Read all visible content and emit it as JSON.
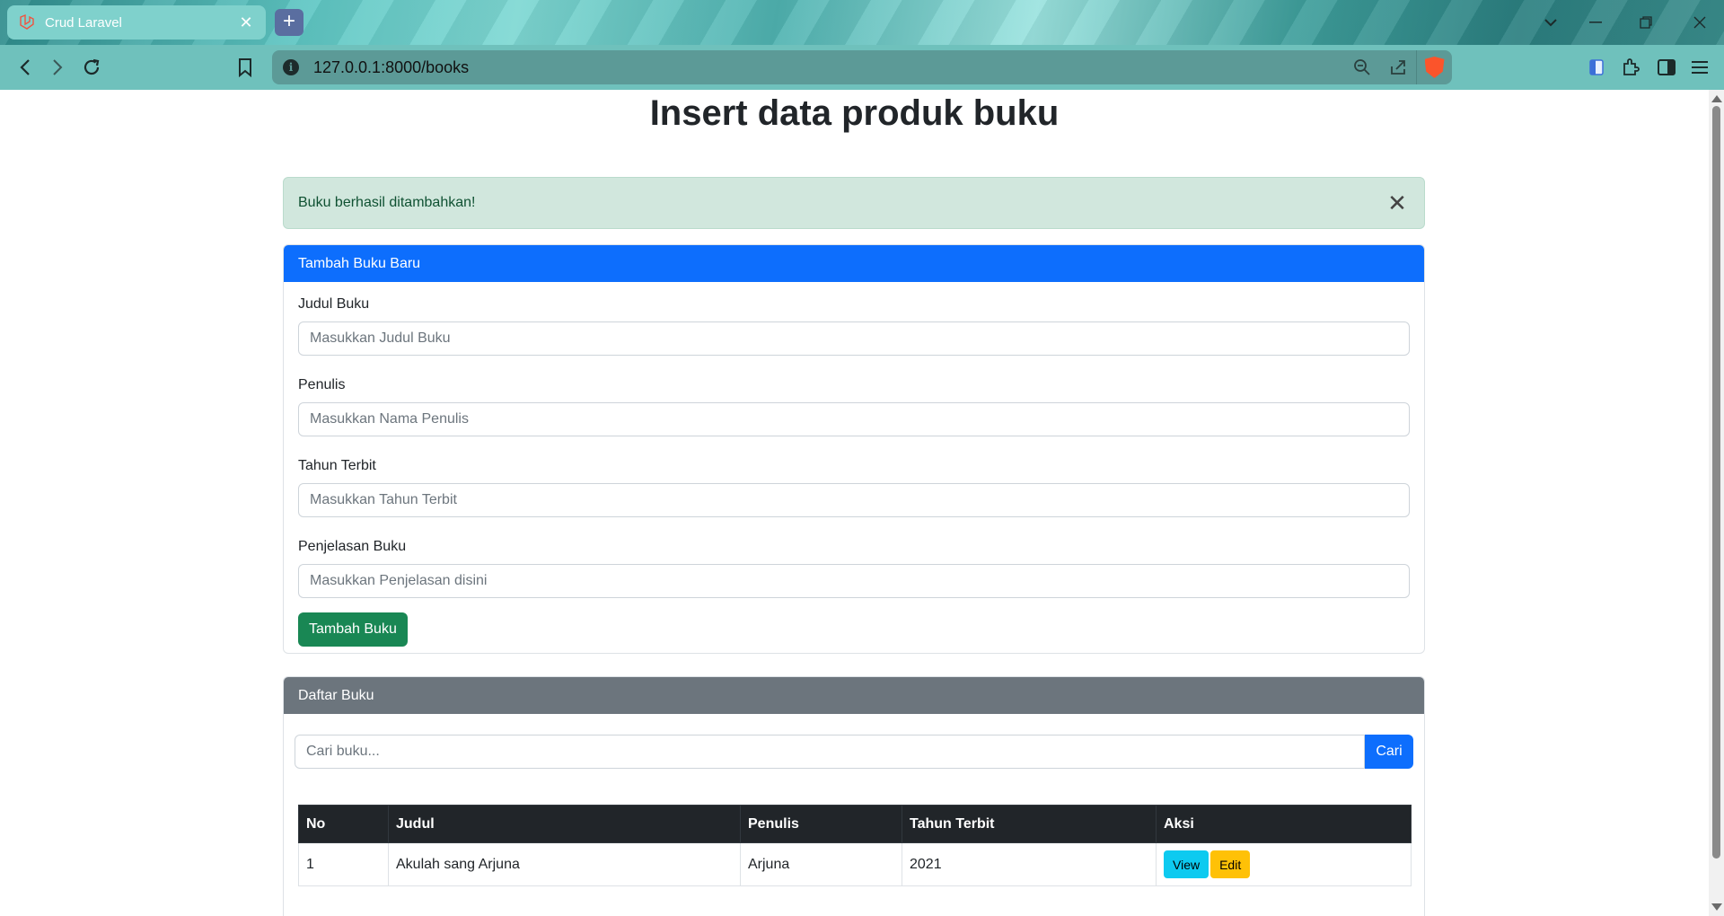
{
  "browser": {
    "tab_title": "Crud Laravel",
    "tab_close": "✕",
    "new_tab": "+",
    "url": "127.0.0.1:8000/books"
  },
  "page": {
    "title": "Insert data produk buku"
  },
  "alert": {
    "message": "Buku berhasil ditambahkan!",
    "close": "✕"
  },
  "add_form": {
    "header": "Tambah Buku Baru",
    "fields": [
      {
        "label": "Judul Buku",
        "placeholder": "Masukkan Judul Buku"
      },
      {
        "label": "Penulis",
        "placeholder": "Masukkan Nama Penulis"
      },
      {
        "label": "Tahun Terbit",
        "placeholder": "Masukkan Tahun Terbit"
      },
      {
        "label": "Penjelasan Buku",
        "placeholder": "Masukkan Penjelasan disini"
      }
    ],
    "submit_label": "Tambah Buku"
  },
  "book_list": {
    "header": "Daftar Buku",
    "search_placeholder": "Cari buku...",
    "search_button": "Cari",
    "columns": [
      "No",
      "Judul",
      "Penulis",
      "Tahun Terbit",
      "Aksi"
    ],
    "rows": [
      {
        "no": "1",
        "judul": "Akulah sang Arjuna",
        "penulis": "Arjuna",
        "tahun": "2021",
        "view_label": "View",
        "edit_label": "Edit"
      }
    ]
  },
  "colors": {
    "primary": "#0d6efd",
    "success": "#198754",
    "secondary": "#6c757d",
    "info": "#0dcaf0",
    "warning": "#ffc107",
    "alert_bg": "#d1e7dd"
  }
}
